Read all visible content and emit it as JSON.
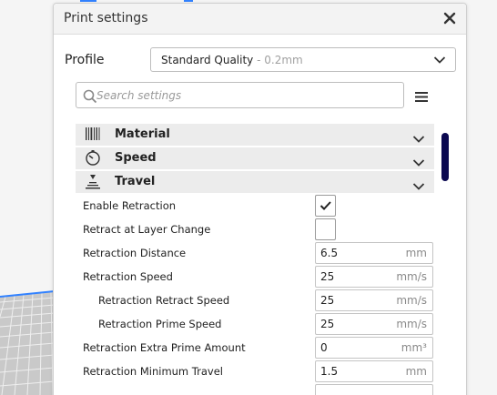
{
  "panel": {
    "title": "Print settings",
    "close_icon": "close-icon"
  },
  "profile": {
    "label": "Profile",
    "value": "Standard Quality",
    "detail": " - 0.2mm"
  },
  "search": {
    "placeholder": "Search settings",
    "icon": "search-icon",
    "menu_icon": "hamburger-menu-icon"
  },
  "categories": [
    {
      "label": "Material",
      "icon": "material-spool-icon"
    },
    {
      "label": "Speed",
      "icon": "speedometer-icon"
    },
    {
      "label": "Travel",
      "icon": "travel-icon"
    }
  ],
  "settings": [
    {
      "name": "Enable Retraction",
      "type": "checkbox",
      "checked": true
    },
    {
      "name": "Retract at Layer Change",
      "type": "checkbox",
      "checked": false
    },
    {
      "name": "Retraction Distance",
      "value": "6.5",
      "unit": "mm"
    },
    {
      "name": "Retraction Speed",
      "value": "25",
      "unit": "mm/s"
    },
    {
      "name": "Retraction Retract Speed",
      "value": "25",
      "unit": "mm/s"
    },
    {
      "name": "Retraction Prime Speed",
      "value": "25",
      "unit": "mm/s"
    },
    {
      "name": "Retraction Extra Prime Amount",
      "value": "0",
      "unit": "mm³"
    },
    {
      "name": "Retraction Minimum Travel",
      "value": "1.5",
      "unit": "mm"
    }
  ],
  "colors": {
    "scrollbar": "#0a0850",
    "category_bg": "#ececec",
    "accent_blue": "#3282ff"
  }
}
